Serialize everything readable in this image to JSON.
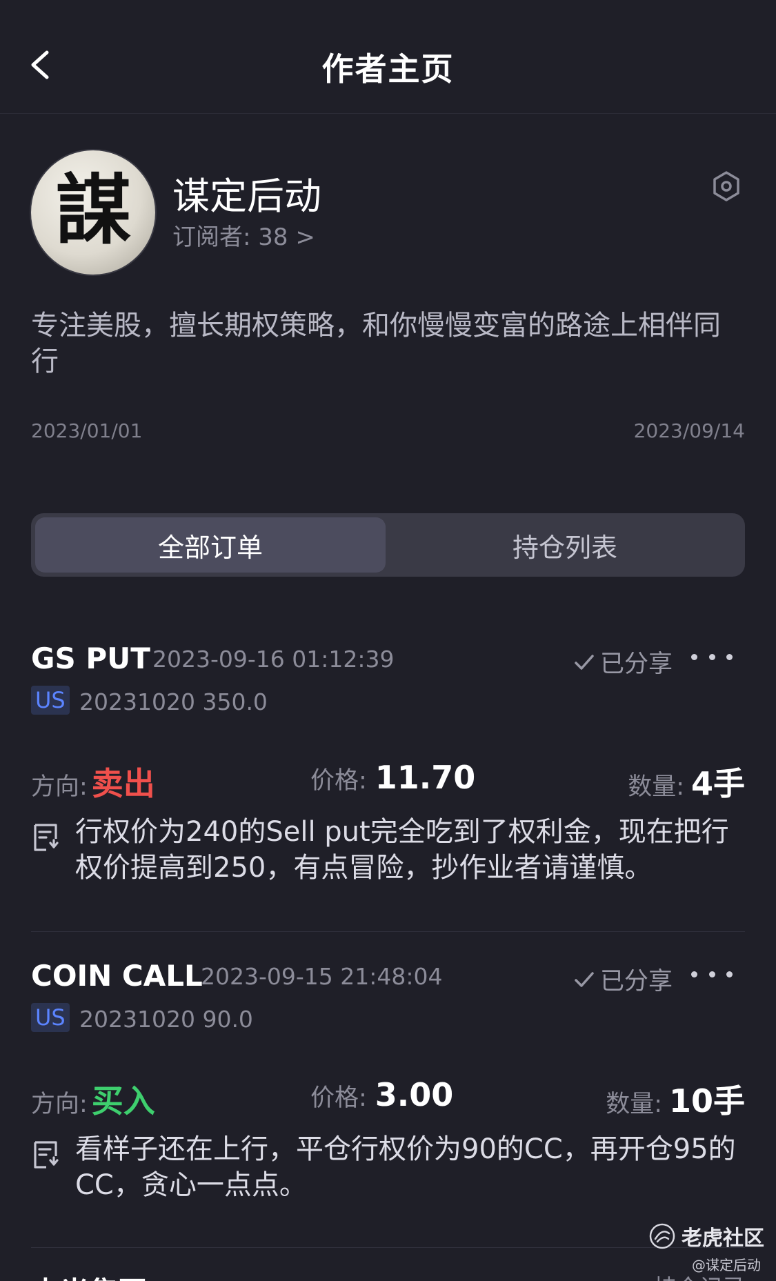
{
  "header": {
    "title": "作者主页"
  },
  "profile": {
    "name": "谋定后动",
    "subscribers": "订阅者: 38 >",
    "avatar_char": "謀",
    "bio": "专注美股，擅长期权策略，和你慢慢变富的路途上相伴同行",
    "date_start": "2023/01/01",
    "date_end": "2023/09/14"
  },
  "tabs": [
    {
      "label": "全部订单"
    },
    {
      "label": "持仓列表"
    }
  ],
  "labels": {
    "direction": "方向:",
    "price": "价格:",
    "qty": "数量:",
    "shared": "已分享"
  },
  "orders": [
    {
      "symbol": "GS PUT",
      "time": "2023-09-16 01:12:39",
      "market": "US",
      "contract": "20231020 350.0",
      "direction": "卖出",
      "price": "11.70",
      "qty": "4手",
      "note": "行权价为240的Sell put完全吃到了权利金，现在把行权价提高到250，有点冒险，抄作业者请谨慎。"
    },
    {
      "symbol": "COIN CALL",
      "time": "2023-09-15 21:48:04",
      "market": "US",
      "contract": "20231020 90.0",
      "direction": "买入",
      "price": "3.00",
      "qty": "10手",
      "note": "看样子还在上行，平仓行权价为90的CC，再开仓95的CC，贪心一点点。"
    }
  ],
  "next_item": {
    "title": "中光集团 W",
    "right": "持仓记录"
  },
  "watermark": {
    "brand": "老虎社区",
    "user": "@谋定后动"
  },
  "colors": {
    "background": "#1f1f28",
    "sell": "#f0504c",
    "buy": "#3ecf6e",
    "badge": "#5b84ff"
  },
  "icons": [
    "back-arrow-icon",
    "settings-hexagon-icon",
    "checkmark-icon",
    "more-dots-icon",
    "note-icon",
    "tiger-logo-icon"
  ]
}
